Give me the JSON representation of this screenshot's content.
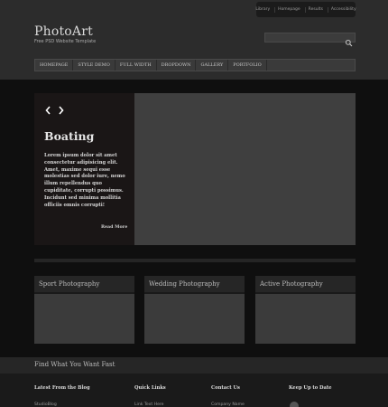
{
  "top_links": [
    "Library",
    "Homepage",
    "Results",
    "Accessibility"
  ],
  "site": {
    "name": "PhotoArt",
    "tagline": "Free PSD Website Template"
  },
  "search": {
    "placeholder": ""
  },
  "nav": [
    "HOMEPAGE",
    "STYLE DEMO",
    "FULL WIDTH",
    "DROPDOWN",
    "GALLERY",
    "PORTFOLIO"
  ],
  "slider": {
    "title": "Boating",
    "text": "Lorem ipsum dolor sit amet consectetur adipisicing elit. Amet, maxime sequi esse molestias sed dolor iure, nemo illum repellendus quo cupiditate, corrupti possimus. Incidunt sed minima mollitia officiis omnis corrupti!",
    "read_more": "Read More"
  },
  "categories": [
    "Sport Photography",
    "Wedding Photography",
    "Active Photography"
  ],
  "footer": {
    "find_title": "Find What You Want Fast",
    "columns": [
      {
        "heading": "Latest From the Blog",
        "first_item": "StudioBlog"
      },
      {
        "heading": "Quick Links",
        "first_item": "Link Text Here"
      },
      {
        "heading": "Contact Us",
        "first_item": "Company Name"
      },
      {
        "heading": "Keep Up to Date",
        "first_item": ""
      }
    ]
  }
}
